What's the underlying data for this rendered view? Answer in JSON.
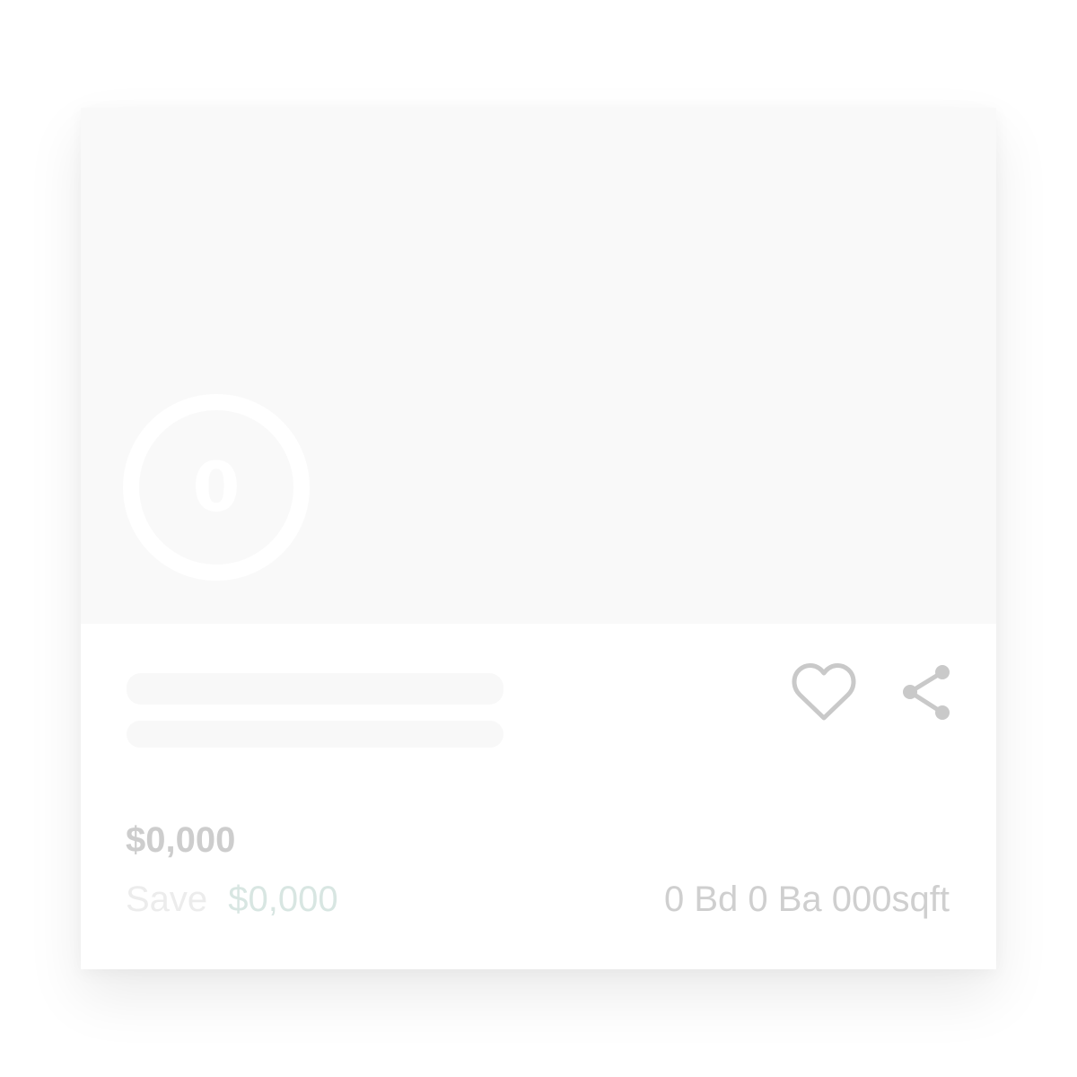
{
  "listing": {
    "score": "0",
    "price": "$0,000",
    "savings_label": "Save",
    "savings_amount": "$0,000",
    "specs": "0 Bd 0 Ba 000sqft"
  },
  "actions": {
    "favorite_icon": "heart-outline-icon",
    "share_icon": "share-icon"
  },
  "colors": {
    "image_placeholder": "#f9f9f9",
    "skeleton": "#f8f8f8",
    "icon": "#c9c9c9",
    "price": "#cdcdcd",
    "savings_amount": "#d8e6e2"
  }
}
